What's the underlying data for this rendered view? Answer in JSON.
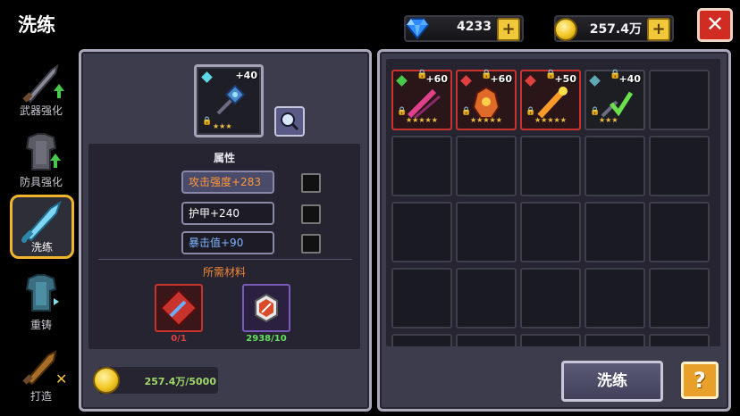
{
  "header": {
    "title": "洗练",
    "gems": "4233",
    "gold": "257.4万",
    "plus_symbol": "+",
    "close_symbol": "✕"
  },
  "sidebar": {
    "items": [
      {
        "label": "武器强化",
        "icon": "sword-upgrade-icon",
        "active": false
      },
      {
        "label": "防具强化",
        "icon": "armor-upgrade-icon",
        "active": false
      },
      {
        "label": "洗练",
        "icon": "wash-sword-icon",
        "active": true
      },
      {
        "label": "重铸",
        "icon": "recast-armor-icon",
        "active": false
      },
      {
        "label": "打造",
        "icon": "forge-icon",
        "active": false
      }
    ]
  },
  "left_panel": {
    "selected_item": {
      "level": "+40",
      "stars": "★★★"
    },
    "attributes_title": "属性",
    "attributes": [
      {
        "label": "攻击强度+283",
        "color": "#ff9a3a"
      },
      {
        "label": "护甲+240",
        "color": "#ffffff"
      },
      {
        "label": "暴击值+90",
        "color": "#7fb4ff"
      }
    ],
    "materials_title": "所需材料",
    "materials": [
      {
        "count": "0/1",
        "color": "#e04040"
      },
      {
        "count": "2938/10",
        "color": "#66e060"
      }
    ],
    "gold_cost": "257.4万/5000"
  },
  "inventory": {
    "items": [
      {
        "level": "+60",
        "stars": "★★★★★"
      },
      {
        "level": "+60",
        "stars": "★★★★★"
      },
      {
        "level": "+50",
        "stars": "★★★★★"
      },
      {
        "level": "+40",
        "stars": "★★★"
      }
    ]
  },
  "actions": {
    "wash_label": "洗练",
    "help_label": "?"
  }
}
